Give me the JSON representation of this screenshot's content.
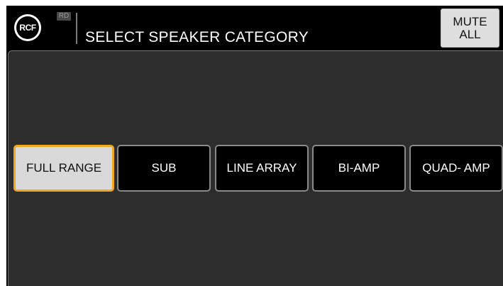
{
  "header": {
    "logo_text": "RCF",
    "badge": "RD",
    "title": "SELECT SPEAKER CATEGORY",
    "mute_line1": "MUTE",
    "mute_line2": "ALL"
  },
  "categories": [
    {
      "label": "FULL RANGE",
      "selected": true
    },
    {
      "label": "SUB",
      "selected": false
    },
    {
      "label": "LINE ARRAY",
      "selected": false
    },
    {
      "label": "BI-AMP",
      "selected": false
    },
    {
      "label": "QUAD- AMP",
      "selected": false
    }
  ],
  "colors": {
    "selected_border": "#f2a81d",
    "panel_bg": "#2d2d2d",
    "button_bg": "#000000"
  }
}
